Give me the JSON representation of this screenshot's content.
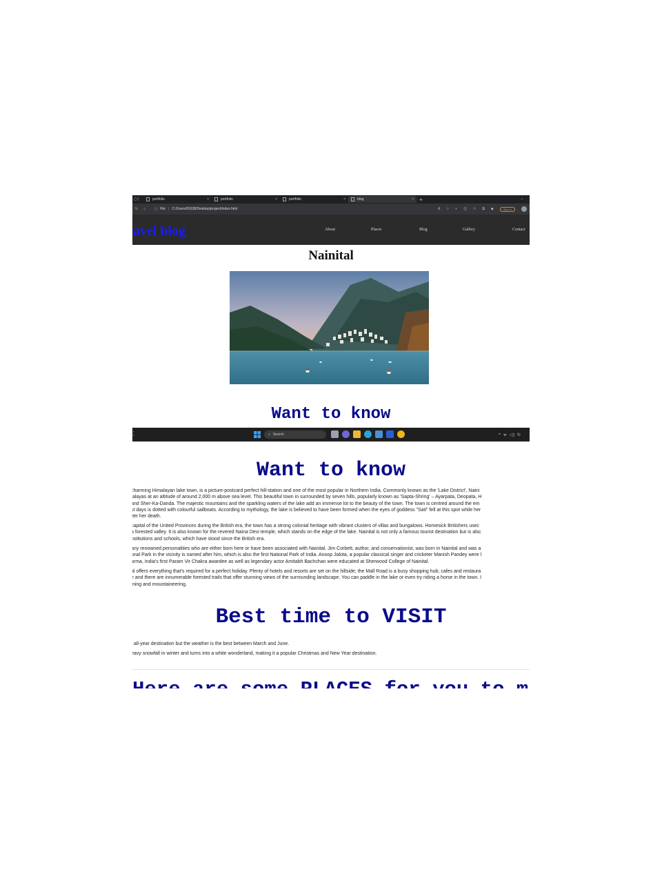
{
  "browser": {
    "tabs": [
      {
        "label": "portfolio",
        "close": "×"
      },
      {
        "label": "portfolio",
        "close": "×"
      },
      {
        "label": "portfolio",
        "close": "×"
      },
      {
        "label": "blog",
        "close": "×"
      }
    ],
    "new_tab": "+",
    "minimize": "–",
    "address_prefix": "File",
    "address": "C:/Users/91638/Desktop/project/index.html",
    "sign_in": "Sign in"
  },
  "site": {
    "logo": "ravel blog",
    "nav": [
      "About",
      "Places",
      "Blog",
      "Gallery",
      "Contact"
    ],
    "title": "Nainital"
  },
  "sections": {
    "want_to_know_top": "Want to know",
    "want_to_know": "Want to know",
    "best_time": "Best time to VISIT",
    "places_partial": "Here are some PLACES for you to must visit"
  },
  "paragraphs": {
    "intro": [
      "charming Himalayan lake town, is a picture-postcard perfect hill-station and one of the most popular in Northern India. Commonly known as the 'Lake District', Naini",
      "ıalayas at an altitude of around 2,000 m above sea level. This beautiful town in surrounded by seven hills, popularly known as 'Sapta-Shring' – Ayarpata, Deopata, H",
      "and Sher-Ka-Danda. The majestic mountains and the sparkling waters of the lake add an immense lot to the beauty of the town. The town is centred around the em",
      "st days is dotted with colourful sailboats. According to mythology, the lake is believed to have been formed when the eyes of goddess \"Sati\" fell at this spot while her",
      "fter her death."
    ],
    "history": [
      "capital of the United Provinces during the British era, the town has a strong colonial heritage with vibrant clusters of villas and bungalows. Homesick Britishers usec",
      "a forested valley. It is also known for the revered Naina Devi temple, which stands on the edge of the lake. Nainital is not only a famous tourist destination but is alsc",
      "nstitutions and schools, which have stood since the British era."
    ],
    "people": [
      "any renowned personalities who are either born here or have been associated with Nainital. Jim Corbett, author, and conservationist, was born in Nainital and was a",
      "onal Park in the vicinity is named after him, which is also the first National Park of India. Anoop Jalota, a popular classical singer and cricketer Manish Pandey were l",
      "arma, India's first Param Vir Chakra awardee as well as legendary actor Amitabh Bachchan were educated at Sherwood College of Nainital."
    ],
    "holiday": [
      "al offers everything that's required for a perfect holiday. Plenty of hotels and resorts are set on the hillside; the Mall Road is a busy shopping hub; cafes and restaura",
      "e and there are innumerable forested trails that offer stunning views of the surrounding landscape. You can paddle in the lake or even try riding a horse in the town. I",
      "ıning and mountaineering."
    ],
    "best_time_1": [
      "ı all-year destination but the weather is the best between March and June."
    ],
    "best_time_2": [
      "eavy snowfall in winter and turns into a white wonderland, making it a popular Christmas and New Year destination."
    ]
  },
  "taskbar": {
    "search_placeholder": "Search",
    "tray": "^ ᯤ ◁) ↻"
  }
}
